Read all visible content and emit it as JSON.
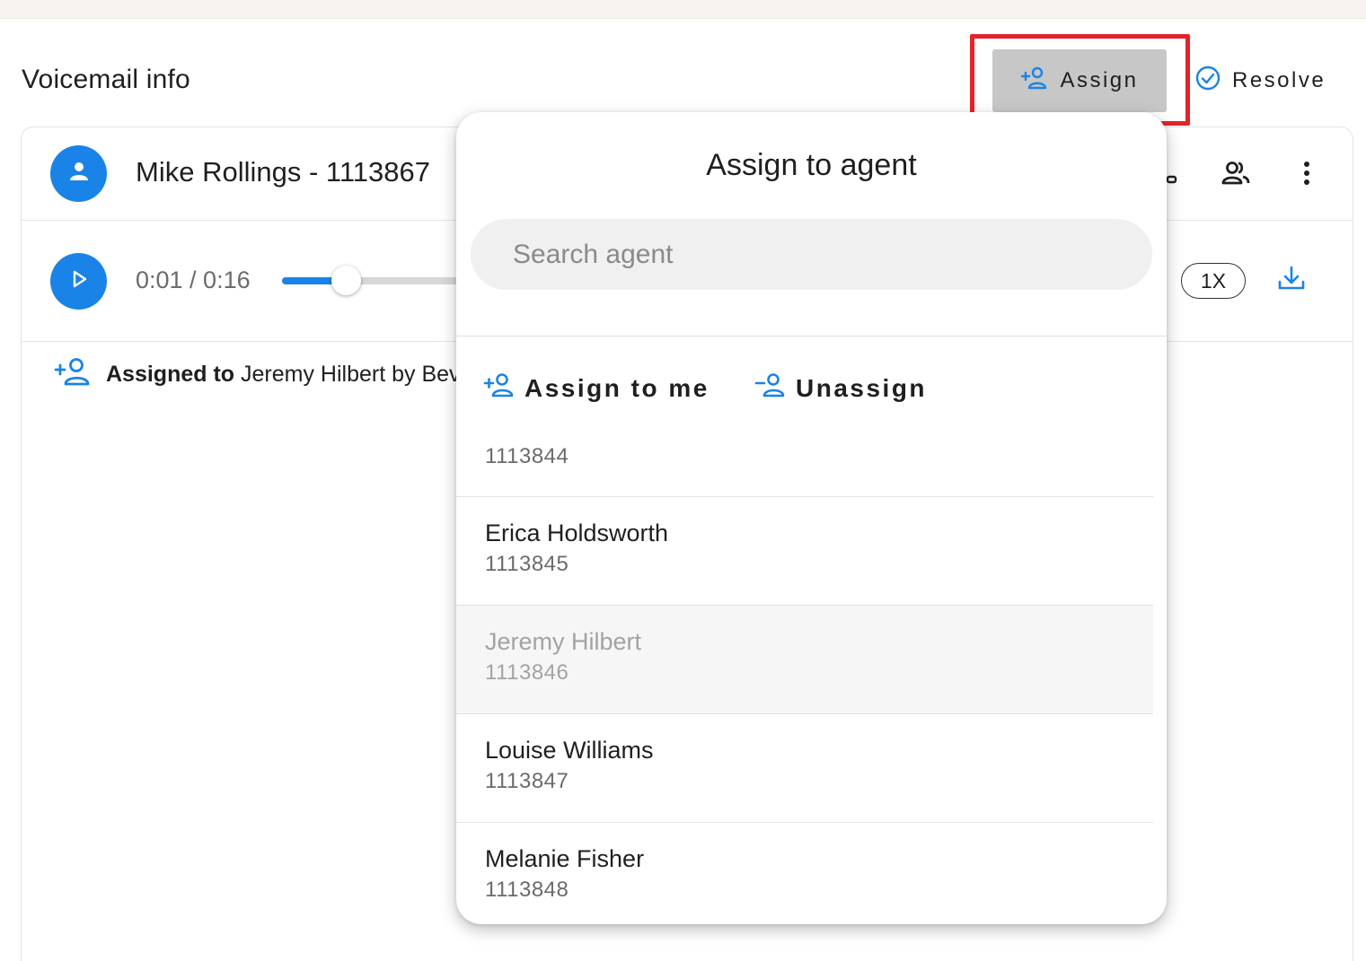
{
  "page": {
    "title": "Voicemail info"
  },
  "header_actions": {
    "assign_label": "Assign",
    "resolve_label": "Resolve"
  },
  "caller": {
    "name_line": "Mike Rollings - 1113867"
  },
  "player": {
    "time": "0:01 / 0:16",
    "progress_fraction": 0.06,
    "speed": "1X"
  },
  "activity": {
    "assigned_prefix": "Assigned to",
    "assigned_rest": " Jeremy Hilbert by Bev"
  },
  "popup": {
    "title": "Assign to agent",
    "search_placeholder": "Search agent",
    "assign_to_me_label": "Assign to me",
    "unassign_label": "Unassign",
    "agents": [
      {
        "name": "",
        "ext": "1113844",
        "state": "partial"
      },
      {
        "name": "Erica Holdsworth",
        "ext": "1113845",
        "state": "normal"
      },
      {
        "name": "Jeremy Hilbert",
        "ext": "1113846",
        "state": "current"
      },
      {
        "name": "Louise Williams",
        "ext": "1113847",
        "state": "normal"
      },
      {
        "name": "Melanie Fisher",
        "ext": "1113848",
        "state": "normal"
      }
    ]
  },
  "colors": {
    "accent": "#1a83e8",
    "highlight": "#e5232b",
    "assign_button_bg": "#c7c7c7"
  },
  "icons": [
    "person-add-icon",
    "check-circle-icon",
    "person-icon",
    "group-icon",
    "more-vert-icon",
    "play-icon",
    "download-icon",
    "person-remove-icon"
  ]
}
